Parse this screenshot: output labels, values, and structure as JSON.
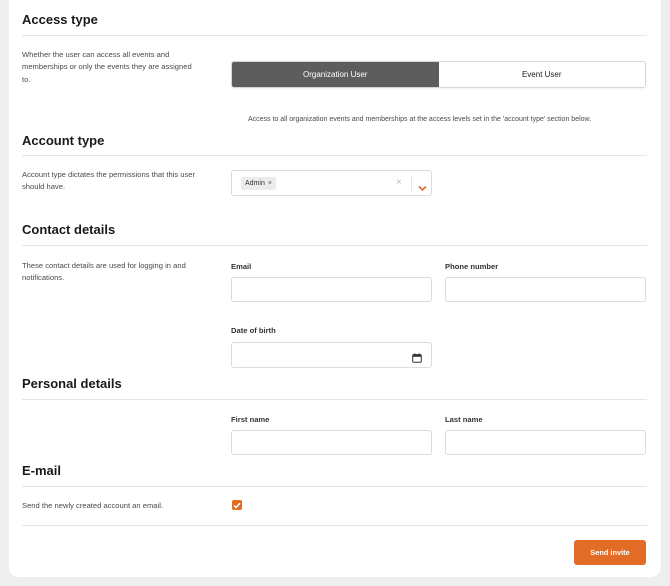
{
  "access_type": {
    "title": "Access type",
    "description": "Whether the user can access all events and memberships or only the events they are assigned to.",
    "options": [
      "Organization User",
      "Event User"
    ],
    "selected": "Organization User",
    "help": "Access to all organization events and memberships at the access levels set in the 'account type' section below."
  },
  "account_type": {
    "title": "Account type",
    "description": "Account type dictates the permissions that this user should have.",
    "chips": [
      {
        "label": "Admin",
        "remove": "×"
      }
    ],
    "clear": "×"
  },
  "contact_details": {
    "title": "Contact details",
    "description": "These contact details are used for logging in and notifications.",
    "email_label": "Email",
    "email_value": "",
    "phone_label": "Phone number",
    "phone_value": "",
    "dob_label": "Date of birth",
    "dob_value": ""
  },
  "personal_details": {
    "title": "Personal details",
    "first_name_label": "First name",
    "first_name_value": "",
    "last_name_label": "Last name",
    "last_name_value": ""
  },
  "email_section": {
    "title": "E-mail",
    "description": "Send the newly created account an email.",
    "checked": true
  },
  "actions": {
    "send_label": "Send invite"
  },
  "colors": {
    "accent": "#e26c26",
    "toggle_active": "#5d5d5d"
  },
  "icons": {
    "chevron": "chevron-down-icon",
    "calendar": "calendar-icon",
    "check": "check-icon",
    "clear": "close-icon"
  }
}
